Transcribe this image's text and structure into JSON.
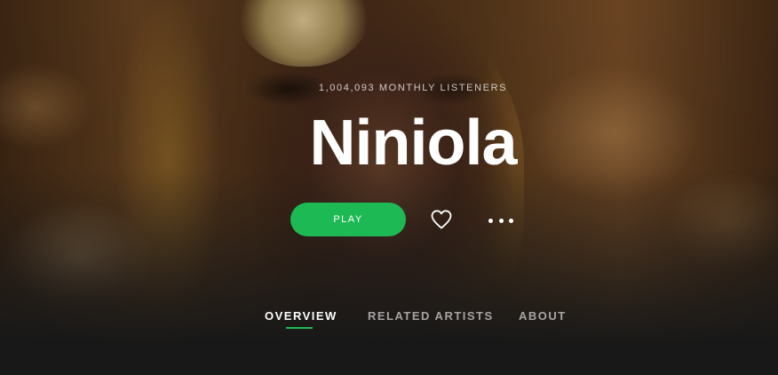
{
  "artist": {
    "monthly_listeners": "1,004,093 MONTHLY LISTENERS",
    "name": "Niniola"
  },
  "actions": {
    "play_label": "PLAY",
    "follow_icon": "heart-icon",
    "more_icon": "more-icon"
  },
  "tabs": [
    {
      "label": "OVERVIEW",
      "active": true
    },
    {
      "label": "RELATED ARTISTS",
      "active": false
    },
    {
      "label": "ABOUT",
      "active": false
    }
  ],
  "colors": {
    "accent": "#1db954",
    "background": "#181818",
    "text": "#ffffff"
  }
}
